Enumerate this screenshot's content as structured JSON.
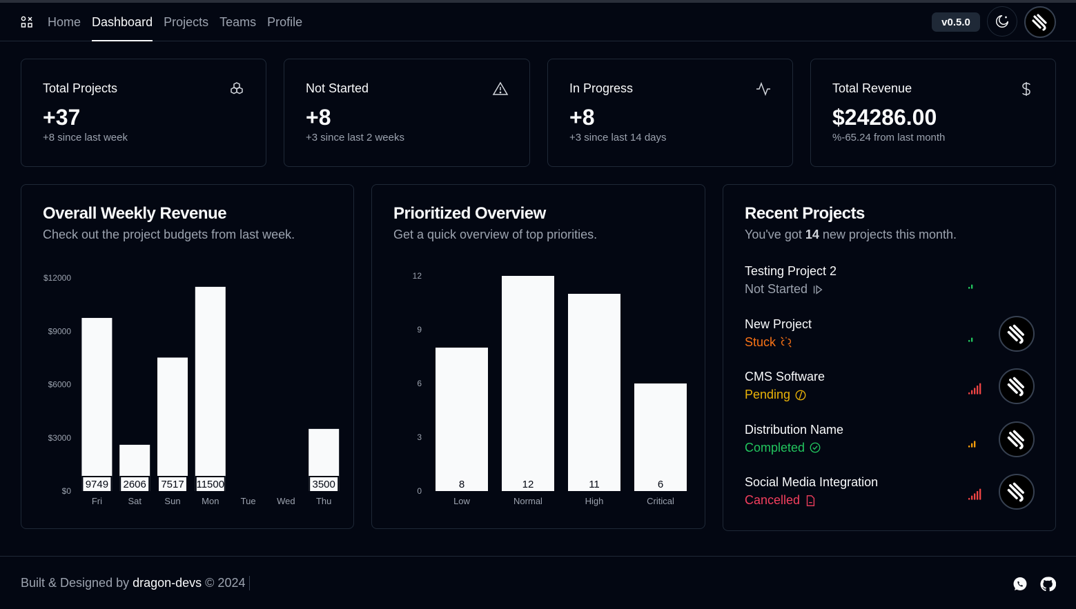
{
  "header": {
    "nav": [
      "Home",
      "Dashboard",
      "Projects",
      "Teams",
      "Profile"
    ],
    "active_nav": "Dashboard",
    "version": "v0.5.0"
  },
  "stats": [
    {
      "title": "Total Projects",
      "value": "+37",
      "sub": "+8 since last week",
      "icon": "boxes-icon"
    },
    {
      "title": "Not Started",
      "value": "+8",
      "sub": "+3 since last 2 weeks",
      "icon": "warning-icon"
    },
    {
      "title": "In Progress",
      "value": "+8",
      "sub": "+3 since last 14 days",
      "icon": "activity-icon"
    },
    {
      "title": "Total Revenue",
      "value": "$24286.00",
      "sub": "%-65.24 from last month",
      "icon": "dollar-icon"
    }
  ],
  "revenue_card": {
    "title": "Overall Weekly Revenue",
    "subtitle": "Check out the project budgets from last week."
  },
  "priority_card": {
    "title": "Prioritized Overview",
    "subtitle": "Get a quick overview of top priorities."
  },
  "chart_data": [
    {
      "type": "bar",
      "categories": [
        "Fri",
        "Sat",
        "Sun",
        "Mon",
        "Tue",
        "Wed",
        "Thu"
      ],
      "values": [
        9749,
        2606,
        7517,
        11500,
        0,
        0,
        3500
      ],
      "data_labels": [
        "9749",
        "2606",
        "7517",
        "11500",
        "",
        "",
        "3500"
      ],
      "y_ticks": [
        "$0",
        "$3000",
        "$6000",
        "$9000",
        "$12000"
      ],
      "ylim": [
        0,
        12000
      ],
      "grid": false
    },
    {
      "type": "bar",
      "categories": [
        "Low",
        "Normal",
        "High",
        "Critical"
      ],
      "values": [
        8,
        12,
        11,
        6
      ],
      "data_labels": [
        "8",
        "12",
        "11",
        "6"
      ],
      "y_ticks": [
        "0",
        "3",
        "6",
        "9",
        "12"
      ],
      "ylim": [
        0,
        12
      ],
      "grid": false
    }
  ],
  "recent": {
    "title": "Recent Projects",
    "subtitle_pre": "You've got ",
    "count": "14",
    "subtitle_post": " new projects this month.",
    "projects": [
      {
        "name": "Testing Project 2",
        "status": "Not Started",
        "status_color": "#9ca3af",
        "status_icon": "play-icon",
        "signal": "low",
        "signal_color": "#22c55e",
        "has_avatar": false
      },
      {
        "name": "New Project",
        "status": "Stuck",
        "status_color": "#f97316",
        "status_icon": "unlink-icon",
        "signal": "low",
        "signal_color": "#22c55e",
        "has_avatar": true
      },
      {
        "name": "CMS Software",
        "status": "Pending",
        "status_color": "#eab308",
        "status_icon": "pending-icon",
        "signal": "high",
        "signal_color": "#ef4444",
        "has_avatar": true
      },
      {
        "name": "Distribution Name",
        "status": "Completed",
        "status_color": "#22c55e",
        "status_icon": "check-circle-icon",
        "signal": "medium",
        "signal_color": "#f59e0b",
        "has_avatar": true
      },
      {
        "name": "Social Media Integration",
        "status": "Cancelled",
        "status_color": "#f43f5e",
        "status_icon": "file-x-icon",
        "signal": "high",
        "signal_color": "#ef4444",
        "has_avatar": true
      }
    ]
  },
  "footer": {
    "prefix": "Built & Designed by ",
    "author": "dragon-devs",
    "suffix": " © 2024"
  }
}
